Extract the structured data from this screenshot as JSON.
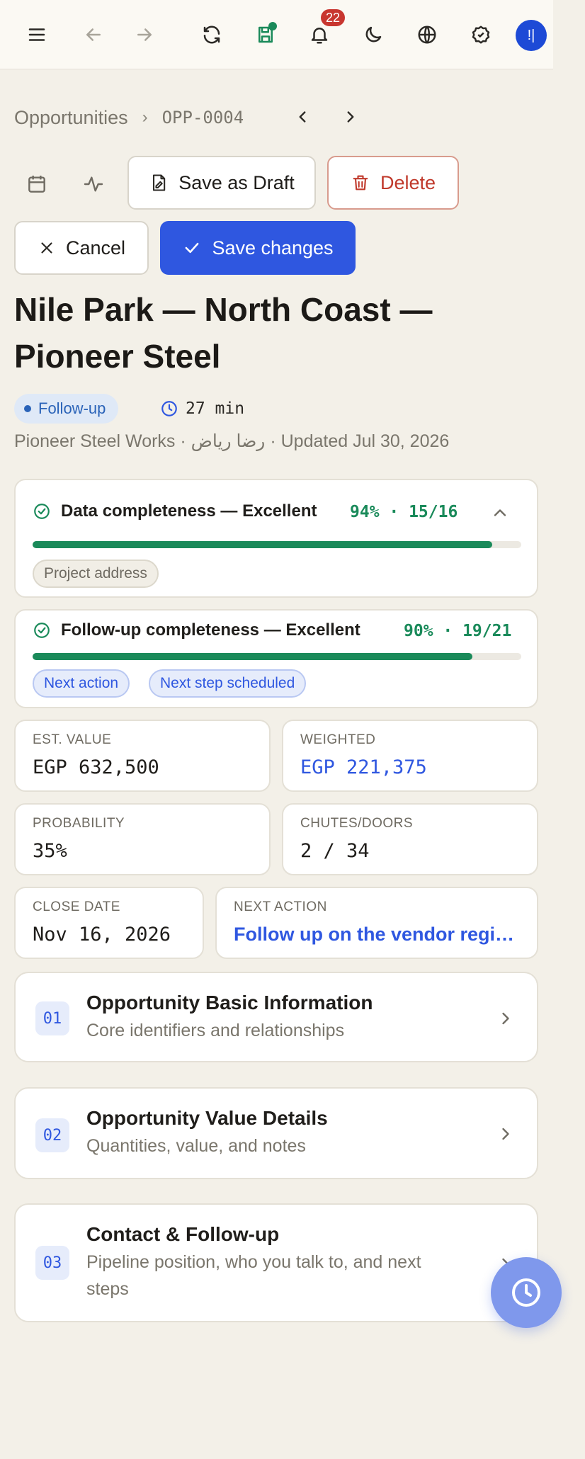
{
  "topbar": {
    "notification_count": "22",
    "avatar_initial": "!|"
  },
  "breadcrumb": {
    "parent": "Opportunities",
    "separator": "›",
    "current": "OPP-0004"
  },
  "actions": {
    "save_draft": "Save as Draft",
    "delete": "Delete",
    "cancel": "Cancel",
    "save_changes": "Save changes"
  },
  "opportunity": {
    "title": "Nile Park — North Coast — Pioneer Steel",
    "status": "Follow-up",
    "timer": "27 min",
    "meta": "Pioneer Steel Works · رضا رياض · Updated Jul 30, 2026"
  },
  "data_completeness": {
    "label": "Data completeness — Excellent",
    "score": "94% · 15/16",
    "fraction": 0.94,
    "missing": [
      "Project address"
    ]
  },
  "followup_completeness": {
    "label": "Follow-up completeness — Excellent",
    "score": "90% · 19/21",
    "fraction": 0.9,
    "missing": [
      "Next action",
      "Next step scheduled"
    ]
  },
  "stats": {
    "est_value": {
      "label": "EST. VALUE",
      "value": "EGP 632,500"
    },
    "weighted": {
      "label": "WEIGHTED",
      "value": "EGP 221,375"
    },
    "probability": {
      "label": "PROBABILITY",
      "value": "35%"
    },
    "chutes_doors": {
      "label": "CHUTES/DOORS",
      "value": "2 / 34"
    },
    "close_date": {
      "label": "CLOSE DATE",
      "value": "Nov 16, 2026"
    },
    "next_action": {
      "label": "NEXT ACTION",
      "value": "Follow up on the vendor registr…"
    }
  },
  "sections": [
    {
      "num": "01",
      "title": "Opportunity Basic Information",
      "subtitle": "Core identifiers and relationships"
    },
    {
      "num": "02",
      "title": "Opportunity Value Details",
      "subtitle": "Quantities, value, and notes"
    },
    {
      "num": "03",
      "title": "Contact & Follow-up",
      "subtitle": "Pipeline position, who you talk to, and next steps"
    }
  ],
  "colors": {
    "accent": "#2f57e0",
    "success": "#1a8a5a",
    "danger": "#c0392b",
    "background": "#f3f0e8"
  }
}
